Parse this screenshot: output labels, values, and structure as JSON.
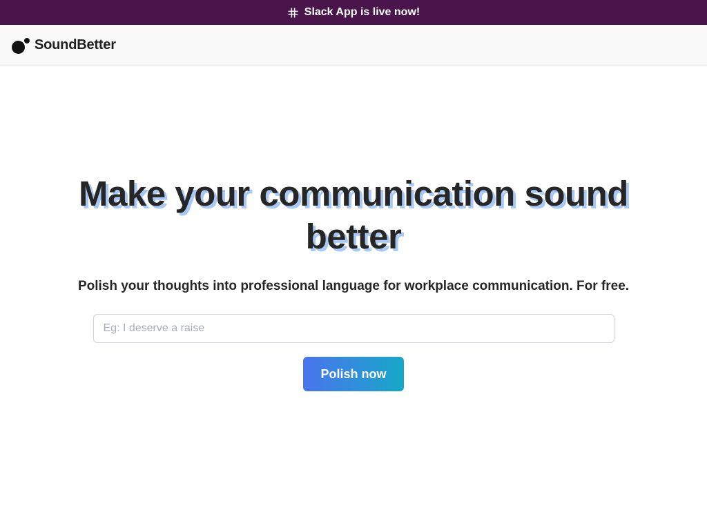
{
  "announcement": {
    "icon": "slack-icon",
    "text": "Slack App is live now!",
    "color": "#4a154b"
  },
  "brand": {
    "name": "SoundBetter",
    "logo": "soundbetter-logo-icon"
  },
  "hero": {
    "headline": "Make your communication sound better",
    "subtitle": "Polish your thoughts into professional language for workplace communication. For free.",
    "input": {
      "value": "",
      "placeholder": "Eg: I deserve a raise"
    },
    "button_label": "Polish now",
    "button_gradient": [
      "#4a74ee",
      "#17a8c8"
    ],
    "headline_shadow_color": "#a9c8f4"
  }
}
